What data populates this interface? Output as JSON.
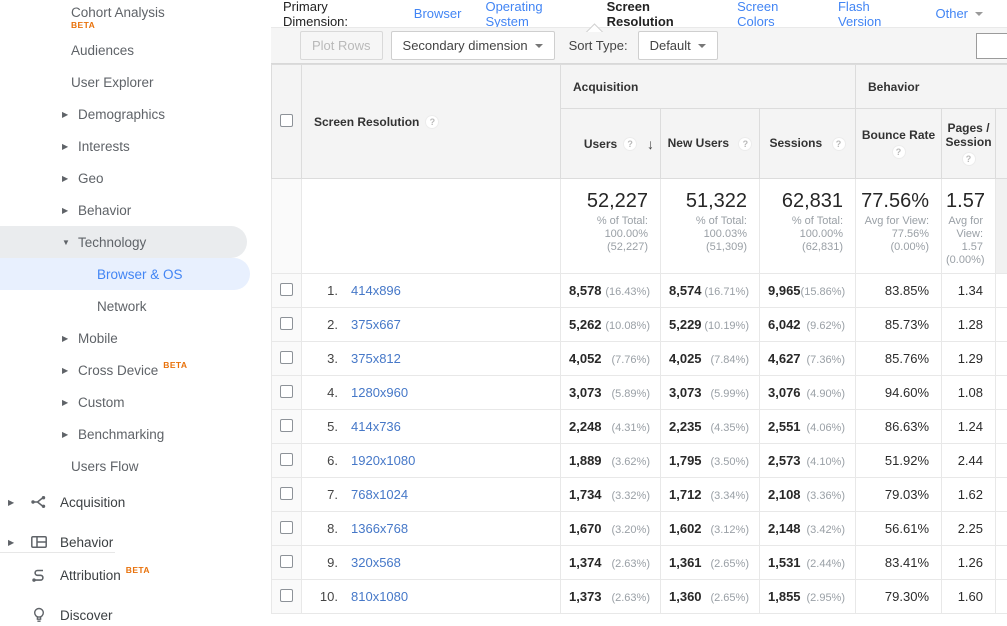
{
  "sidebar": {
    "beta_label": "BETA",
    "report_items": [
      {
        "label": "Cohort Analysis",
        "indent": "plain",
        "beta": "block"
      },
      {
        "label": "Audiences",
        "indent": "plain"
      },
      {
        "label": "User Explorer",
        "indent": "plain"
      },
      {
        "label": "Demographics",
        "arrow": "right"
      },
      {
        "label": "Interests",
        "arrow": "right"
      },
      {
        "label": "Geo",
        "arrow": "right"
      },
      {
        "label": "Behavior",
        "arrow": "right"
      },
      {
        "label": "Technology",
        "arrow": "down",
        "highlighted": true
      },
      {
        "label": "Browser & OS",
        "indent": "sub",
        "selected": true
      },
      {
        "label": "Network",
        "indent": "sub"
      },
      {
        "label": "Mobile",
        "arrow": "right"
      },
      {
        "label": "Cross Device",
        "arrow": "right",
        "beta": "inline"
      },
      {
        "label": "Custom",
        "arrow": "right"
      },
      {
        "label": "Benchmarking",
        "arrow": "right"
      },
      {
        "label": "Users Flow",
        "indent": "plain"
      }
    ],
    "section_items": [
      {
        "label": "Acquisition",
        "icon": "acquisition-icon",
        "arrow": true
      },
      {
        "label": "Behavior",
        "icon": "behavior-icon",
        "arrow": true
      },
      {
        "label": "Attribution",
        "icon": "attribution-icon",
        "beta": "inline"
      },
      {
        "label": "Discover",
        "icon": "discover-icon"
      }
    ]
  },
  "dimension_bar": {
    "label": "Primary Dimension:",
    "options": [
      {
        "label": "Browser"
      },
      {
        "label": "Operating System"
      },
      {
        "label": "Screen Resolution",
        "selected": true
      },
      {
        "label": "Screen Colors"
      },
      {
        "label": "Flash Version"
      },
      {
        "label": "Other",
        "dropdown": true
      }
    ]
  },
  "toolbar": {
    "plot_rows_label": "Plot Rows",
    "secondary_dimension_label": "Secondary dimension",
    "sort_type_label": "Sort Type:",
    "sort_type_value": "Default",
    "search_value": ""
  },
  "table": {
    "groups": {
      "acquisition": "Acquisition",
      "behavior": "Behavior"
    },
    "dimension_header": "Screen Resolution",
    "columns": {
      "users": "Users",
      "new_users": "New Users",
      "sessions": "Sessions",
      "bounce_rate": "Bounce Rate",
      "pages_session": "Pages / Session"
    },
    "summary": {
      "users": {
        "value": "52,227",
        "sub": "% of Total: 100.00% (52,227)"
      },
      "new_users": {
        "value": "51,322",
        "sub": "% of Total: 100.03% (51,309)"
      },
      "sessions": {
        "value": "62,831",
        "sub": "% of Total: 100.00% (62,831)"
      },
      "bounce_rate": {
        "value": "77.56%",
        "sub": "Avg for View: 77.56% (0.00%)"
      },
      "pages_session": {
        "value": "1.57",
        "sub": "Avg for View: 1.57 (0.00%)"
      }
    },
    "rows": [
      {
        "rank": "1.",
        "resolution": "414x896",
        "users": "8,578",
        "users_pct": "(16.43%)",
        "new_users": "8,574",
        "new_users_pct": "(16.71%)",
        "sessions": "9,965",
        "sessions_pct": "(15.86%)",
        "bounce_rate": "83.85%",
        "pages_session": "1.34"
      },
      {
        "rank": "2.",
        "resolution": "375x667",
        "users": "5,262",
        "users_pct": "(10.08%)",
        "new_users": "5,229",
        "new_users_pct": "(10.19%)",
        "sessions": "6,042",
        "sessions_pct": "(9.62%)",
        "bounce_rate": "85.73%",
        "pages_session": "1.28"
      },
      {
        "rank": "3.",
        "resolution": "375x812",
        "users": "4,052",
        "users_pct": "(7.76%)",
        "new_users": "4,025",
        "new_users_pct": "(7.84%)",
        "sessions": "4,627",
        "sessions_pct": "(7.36%)",
        "bounce_rate": "85.76%",
        "pages_session": "1.29"
      },
      {
        "rank": "4.",
        "resolution": "1280x960",
        "users": "3,073",
        "users_pct": "(5.89%)",
        "new_users": "3,073",
        "new_users_pct": "(5.99%)",
        "sessions": "3,076",
        "sessions_pct": "(4.90%)",
        "bounce_rate": "94.60%",
        "pages_session": "1.08"
      },
      {
        "rank": "5.",
        "resolution": "414x736",
        "users": "2,248",
        "users_pct": "(4.31%)",
        "new_users": "2,235",
        "new_users_pct": "(4.35%)",
        "sessions": "2,551",
        "sessions_pct": "(4.06%)",
        "bounce_rate": "86.63%",
        "pages_session": "1.24"
      },
      {
        "rank": "6.",
        "resolution": "1920x1080",
        "users": "1,889",
        "users_pct": "(3.62%)",
        "new_users": "1,795",
        "new_users_pct": "(3.50%)",
        "sessions": "2,573",
        "sessions_pct": "(4.10%)",
        "bounce_rate": "51.92%",
        "pages_session": "2.44"
      },
      {
        "rank": "7.",
        "resolution": "768x1024",
        "users": "1,734",
        "users_pct": "(3.32%)",
        "new_users": "1,712",
        "new_users_pct": "(3.34%)",
        "sessions": "2,108",
        "sessions_pct": "(3.36%)",
        "bounce_rate": "79.03%",
        "pages_session": "1.62"
      },
      {
        "rank": "8.",
        "resolution": "1366x768",
        "users": "1,670",
        "users_pct": "(3.20%)",
        "new_users": "1,602",
        "new_users_pct": "(3.12%)",
        "sessions": "2,148",
        "sessions_pct": "(3.42%)",
        "bounce_rate": "56.61%",
        "pages_session": "2.25"
      },
      {
        "rank": "9.",
        "resolution": "320x568",
        "users": "1,374",
        "users_pct": "(2.63%)",
        "new_users": "1,361",
        "new_users_pct": "(2.65%)",
        "sessions": "1,531",
        "sessions_pct": "(2.44%)",
        "bounce_rate": "83.41%",
        "pages_session": "1.26"
      },
      {
        "rank": "10.",
        "resolution": "810x1080",
        "users": "1,373",
        "users_pct": "(2.63%)",
        "new_users": "1,360",
        "new_users_pct": "(2.65%)",
        "sessions": "1,855",
        "sessions_pct": "(2.95%)",
        "bounce_rate": "79.30%",
        "pages_session": "1.60"
      }
    ],
    "colors": {
      "link_blue": "#4678c8",
      "selected_blue": "#4285f4",
      "beta_orange": "#e8710a"
    }
  }
}
